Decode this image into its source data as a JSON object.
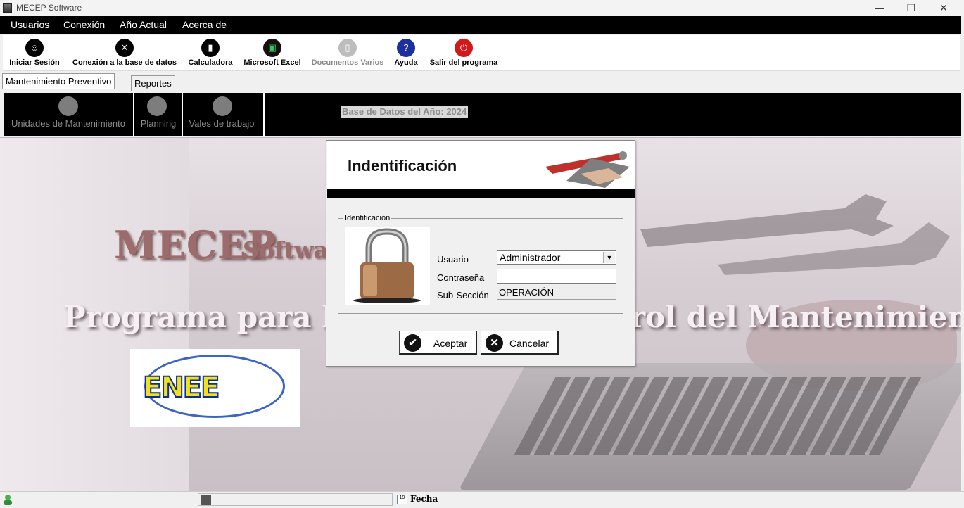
{
  "window": {
    "title": "MECEP Software",
    "minimize": "—",
    "restore": "❐",
    "close": "✕"
  },
  "menu": [
    "Usuarios",
    "Conexión",
    "Año Actual",
    "Acerca de"
  ],
  "toolbar": [
    {
      "label": "Iniciar Sesión",
      "icon": "user-login-icon",
      "enabled": true
    },
    {
      "label": "Conexión a la base de datos",
      "icon": "tools-icon",
      "enabled": true
    },
    {
      "label": "Calculadora",
      "icon": "calculator-icon",
      "enabled": true
    },
    {
      "label": "Microsoft Excel",
      "icon": "excel-icon",
      "enabled": true
    },
    {
      "label": "Documentos Varios",
      "icon": "document-icon",
      "enabled": false
    },
    {
      "label": "Ayuda",
      "icon": "help-icon",
      "enabled": true
    },
    {
      "label": "Salir del programa",
      "icon": "power-icon",
      "enabled": true
    }
  ],
  "tabs": [
    "Mantenimiento Preventivo",
    "Reportes"
  ],
  "ribbon": {
    "items": [
      "Unidades de Mantenimiento",
      "Planning",
      "Vales de trabajo"
    ],
    "db_year": "Base de Datos del Año: 2024"
  },
  "background": {
    "mecep": "MECEP",
    "software": "Software",
    "program_left": "Programa para la A",
    "program_right": "rol del Mantenimiento",
    "logo_text": "ENEE"
  },
  "dialog": {
    "title": "Indentificación",
    "group_legend": "Identificación",
    "usuario_label": "Usuario",
    "usuario_value": "Administrador",
    "password_label": "Contraseña",
    "password_value": "",
    "subsection_label": "Sub-Sección",
    "subsection_value": "OPERACIÓN",
    "accept": "Aceptar",
    "cancel": "Cancelar"
  },
  "statusbar": {
    "date_label": "Fecha",
    "cal_day": "19"
  },
  "colors": {
    "menu_bg": "#000000",
    "ribbon_bg": "#000000",
    "disabled_text": "#8a8a8a"
  }
}
